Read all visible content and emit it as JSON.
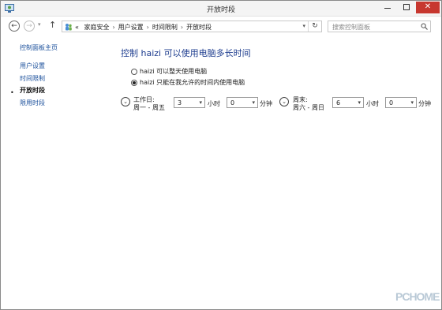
{
  "window": {
    "title": "开放时段"
  },
  "nav": {
    "back": "←",
    "forward": "→",
    "up": "↑",
    "breadcrumb": [
      "家庭安全",
      "用户设置",
      "时间限制",
      "开放时段"
    ],
    "breadcrumb_prefix": "«",
    "refresh": "↻",
    "search_placeholder": "搜索控制面板"
  },
  "sidebar": {
    "items": [
      {
        "label": "控制面板主页"
      },
      {
        "label": "用户设置"
      },
      {
        "label": "时间限制"
      },
      {
        "label": "开放时段"
      },
      {
        "label": "限用时段"
      }
    ],
    "active_bullet": "•"
  },
  "main": {
    "title": "控制 haizi 可以使用电脑多长时间",
    "options": [
      {
        "label": "haizi 可以整天使用电脑",
        "selected": false
      },
      {
        "label": "haizi 只能在我允许的时间内使用电脑",
        "selected": true
      }
    ],
    "weekday": {
      "label_line1": "工作日:",
      "label_line2": "周一 - 周五",
      "hours": "3",
      "hours_unit": "小时",
      "minutes": "0",
      "minutes_unit": "分钟"
    },
    "weekend": {
      "label_line1": "周末:",
      "label_line2": "周六 - 周日",
      "hours": "6",
      "hours_unit": "小时",
      "minutes": "0",
      "minutes_unit": "分钟"
    }
  },
  "watermark": {
    "text": "PCHOME"
  },
  "colors": {
    "link": "#1a4f9b",
    "title": "#1e3d8f",
    "close": "#c7372f"
  }
}
